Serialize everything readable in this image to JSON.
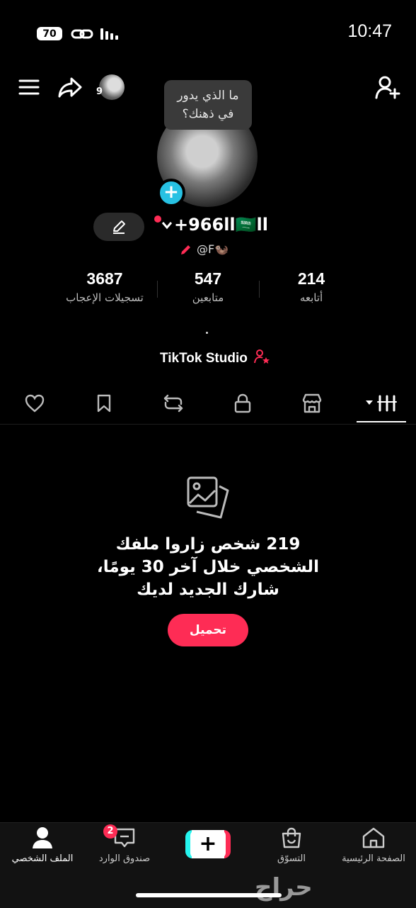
{
  "status_bar": {
    "battery": "70",
    "time": "10:47"
  },
  "header": {
    "story_count": "9",
    "icons": [
      "menu-icon",
      "share-icon",
      "add-friend-icon"
    ]
  },
  "profile": {
    "tooltip": "ما الذي يدور\nفي ذهنك؟",
    "username": "+966ll🇸🇦ll",
    "handle": "@F🦦",
    "stats": [
      {
        "value": "3687",
        "label": "تسجيلات الإعجاب"
      },
      {
        "value": "547",
        "label": "متابعين"
      },
      {
        "value": "214",
        "label": "أتابعه"
      }
    ],
    "studio_label": "TikTok Studio"
  },
  "tabs": [
    "videos",
    "shop",
    "private",
    "reposts",
    "favorites",
    "liked"
  ],
  "empty_state": {
    "message": "219 شخص زاروا ملفك الشخصي خلال آخر 30 يومًا، شارك الجديد لديك",
    "button": "تحميل"
  },
  "bottom_nav": {
    "profile": "الملف الشخصي",
    "inbox": "صندوق الوارد",
    "inbox_badge": "2",
    "shop": "التسوّق",
    "home": "الصفحة الرئيسية"
  },
  "watermark": "حراج",
  "colors": {
    "accent": "#fe2c55",
    "cyan": "#27c1e3",
    "background": "#000000"
  }
}
